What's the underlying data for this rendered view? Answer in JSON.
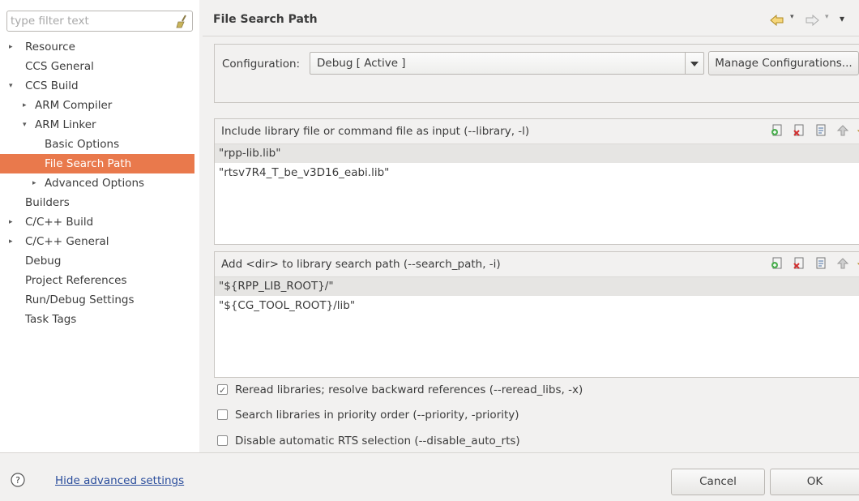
{
  "sidebar": {
    "filter_placeholder": "type filter text",
    "items": [
      {
        "label": "Resource",
        "arrow": "▸"
      },
      {
        "label": "CCS General",
        "arrow": ""
      },
      {
        "label": "CCS Build",
        "arrow": "▾"
      },
      {
        "label": "ARM Compiler",
        "arrow": "▸"
      },
      {
        "label": "ARM Linker",
        "arrow": "▾"
      },
      {
        "label": "Basic Options",
        "arrow": ""
      },
      {
        "label": "File Search Path",
        "arrow": ""
      },
      {
        "label": "Advanced Options",
        "arrow": "▸"
      },
      {
        "label": "Builders",
        "arrow": ""
      },
      {
        "label": "C/C++ Build",
        "arrow": "▸"
      },
      {
        "label": "C/C++ General",
        "arrow": "▸"
      },
      {
        "label": "Debug",
        "arrow": ""
      },
      {
        "label": "Project References",
        "arrow": ""
      },
      {
        "label": "Run/Debug Settings",
        "arrow": ""
      },
      {
        "label": "Task Tags",
        "arrow": ""
      }
    ]
  },
  "page": {
    "title": "File Search Path"
  },
  "config": {
    "label": "Configuration:",
    "value": "Debug  [ Active ]",
    "manage_label": "Manage Configurations..."
  },
  "library_files": {
    "header": "Include library file or command file as input (--library, -l)",
    "items": [
      "\"rpp-lib.lib\"",
      "\"rtsv7R4_T_be_v3D16_eabi.lib\""
    ]
  },
  "search_paths": {
    "header": "Add <dir> to library search path (--search_path, -i)",
    "items": [
      "\"${RPP_LIB_ROOT}/\"",
      "\"${CG_TOOL_ROOT}/lib\""
    ]
  },
  "options": {
    "reread": {
      "label": "Reread libraries; resolve backward references (--reread_libs, -x)",
      "checked": true
    },
    "priority": {
      "label": "Search libraries in priority order (--priority, -priority)",
      "checked": false
    },
    "disable_rts": {
      "label": "Disable automatic RTS selection (--disable_auto_rts)",
      "checked": false
    }
  },
  "footer": {
    "hide_advanced": "Hide advanced settings",
    "cancel": "Cancel",
    "ok": "OK"
  },
  "colors": {
    "selection": "#e9794c",
    "link": "#2a4d9c"
  }
}
